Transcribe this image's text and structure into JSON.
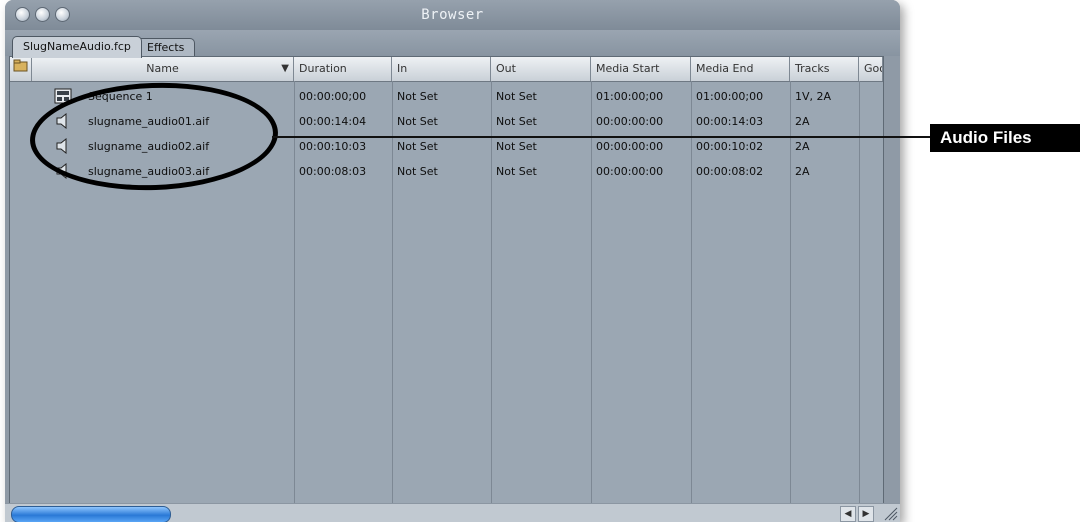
{
  "window": {
    "title": "Browser"
  },
  "tabs": [
    {
      "label": "SlugNameAudio.fcp"
    },
    {
      "label": "Effects"
    }
  ],
  "columns": [
    "Name",
    "Duration",
    "In",
    "Out",
    "Media Start",
    "Media End",
    "Tracks",
    "Goo"
  ],
  "rows": [
    {
      "icon": "sequence-icon",
      "name": "Sequence 1",
      "duration": "00:00:00;00",
      "in": "Not Set",
      "out": "Not Set",
      "media_start": "01:00:00;00",
      "media_end": "01:00:00;00",
      "tracks": "1V, 2A"
    },
    {
      "icon": "speaker-icon",
      "name": "slugname_audio01.aif",
      "duration": "00:00:14:04",
      "in": "Not Set",
      "out": "Not Set",
      "media_start": "00:00:00:00",
      "media_end": "00:00:14:03",
      "tracks": "2A"
    },
    {
      "icon": "speaker-icon",
      "name": "slugname_audio02.aif",
      "duration": "00:00:10:03",
      "in": "Not Set",
      "out": "Not Set",
      "media_start": "00:00:00:00",
      "media_end": "00:00:10:02",
      "tracks": "2A"
    },
    {
      "icon": "speaker-icon",
      "name": "slugname_audio03.aif",
      "duration": "00:00:08:03",
      "in": "Not Set",
      "out": "Not Set",
      "media_start": "00:00:00:00",
      "media_end": "00:00:08:02",
      "tracks": "2A"
    }
  ],
  "callout": {
    "label": "Audio Files"
  },
  "colors": {
    "pane": "#9ba7b3",
    "accent": "#2a79d6",
    "callout": "#000000"
  }
}
